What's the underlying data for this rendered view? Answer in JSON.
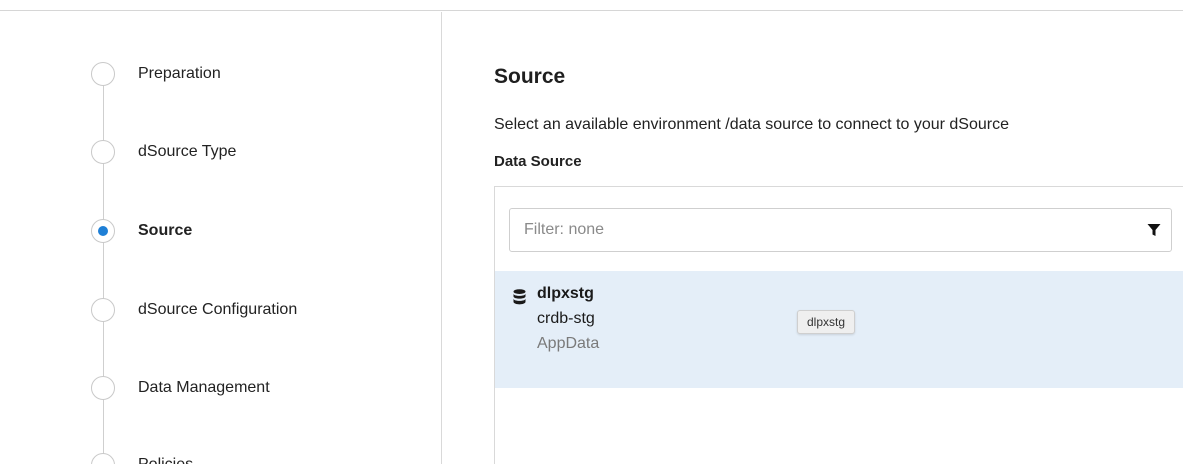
{
  "wizard": {
    "steps": [
      {
        "label": "Preparation",
        "active": false
      },
      {
        "label": "dSource Type",
        "active": false
      },
      {
        "label": "Source",
        "active": true
      },
      {
        "label": "dSource Configuration",
        "active": false
      },
      {
        "label": "Data Management",
        "active": false
      },
      {
        "label": "Policies",
        "active": false
      }
    ]
  },
  "main": {
    "title": "Source",
    "description": "Select an available environment /data source to connect to your dSource",
    "section_label": "Data Source",
    "filter": {
      "placeholder": "Filter: none",
      "icon": "filter-icon"
    },
    "sources": [
      {
        "name": "dlpxstg",
        "environment": "crdb-stg",
        "type": "AppData",
        "icon": "database-icon",
        "selected": true
      }
    ],
    "tooltip": "dlpxstg"
  },
  "colors": {
    "accent": "#1e7fd6",
    "selected_row": "#e4eef8"
  }
}
